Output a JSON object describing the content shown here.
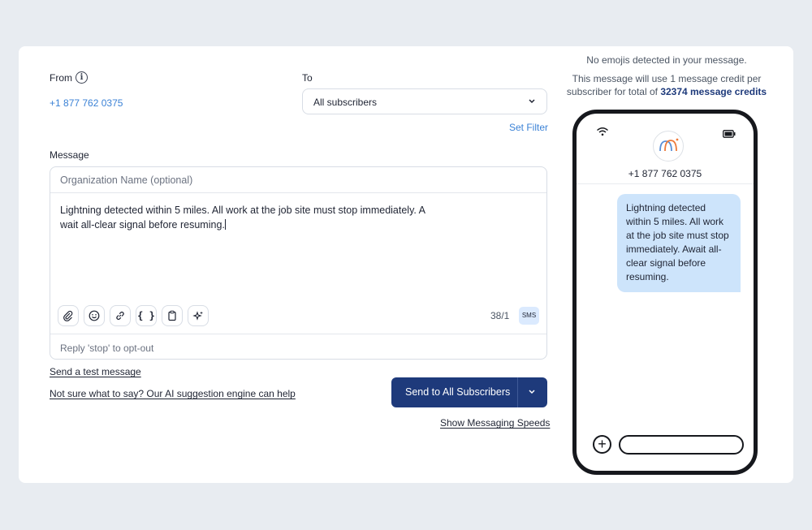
{
  "from": {
    "label": "From",
    "number": "+1 877 762 0375"
  },
  "to": {
    "label": "To",
    "selected": "All subscribers",
    "set_filter": "Set Filter"
  },
  "message": {
    "label": "Message",
    "org_placeholder": "Organization Name (optional)",
    "text_line1": "Lightning detected within 5 miles. All work at the job site must stop immediately. A",
    "text_line2": "wait all-clear signal before resuming.",
    "counter": "38/1",
    "type_badge": "SMS",
    "optout": "Reply 'stop' to opt-out",
    "tools": [
      "paperclip-icon",
      "emoji-icon",
      "link-icon",
      "variable-braces-icon",
      "clipboard-icon",
      "ai-sparkle-icon"
    ]
  },
  "links": {
    "test": "Send a test message",
    "ai": "Not sure what to say? Our AI suggestion engine can help",
    "speeds": "Show Messaging Speeds"
  },
  "send": {
    "label": "Send to All Subscribers"
  },
  "preview": {
    "emoji_note": "No emojis detected in your message.",
    "credit_note_pre": "This message will use 1 message credit per subscriber for total of",
    "credit_count": "32374 message credits",
    "phone_number": "+1 877 762 0375",
    "bubble_text": "Lightning detected within 5 miles. All work at the job site must stop immediately. Await all-clear signal before resuming."
  },
  "colors": {
    "accent": "#1e3a7b",
    "link": "#3b82d6",
    "bubble": "#cde4fb"
  }
}
